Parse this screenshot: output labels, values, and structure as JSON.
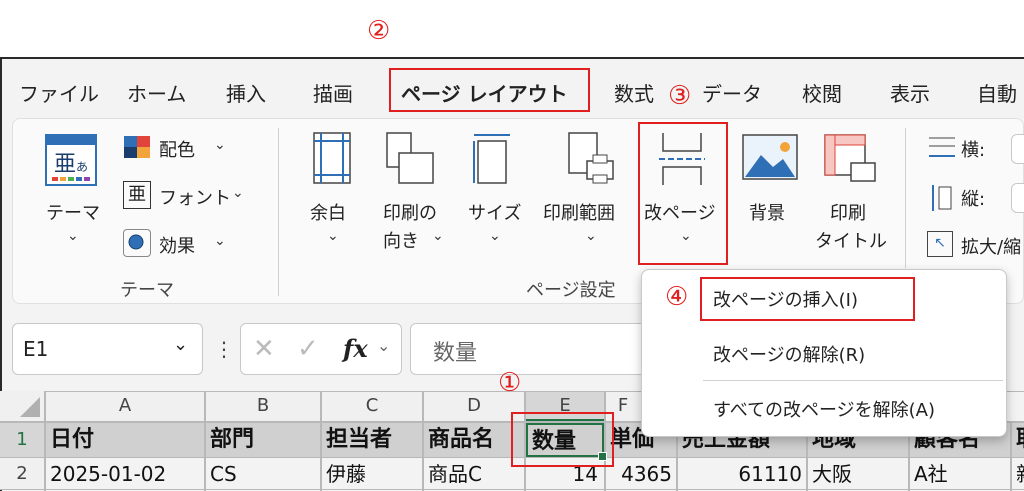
{
  "callouts": {
    "c1": "①",
    "c2": "②",
    "c3": "③",
    "c4": "④"
  },
  "menu": {
    "file": "ファイル",
    "home": "ホーム",
    "insert": "挿入",
    "draw": "描画",
    "page_layout": "ページ レイアウト",
    "formulas": "数式",
    "data": "データ",
    "review": "校閲",
    "view": "表示",
    "automate": "自動"
  },
  "ribbon": {
    "theme_group": {
      "themes_label": "テーマ",
      "colors": "配色",
      "fonts": "フォント",
      "effects": "効果",
      "group_label": "テーマ"
    },
    "margins": "余白",
    "orientation_1": "印刷の",
    "orientation_2": "向き",
    "size": "サイズ",
    "print_area": "印刷範囲",
    "breaks": "改ページ",
    "background": "背景",
    "print_titles_1": "印刷",
    "print_titles_2": "タイトル",
    "page_setup_label": "ページ設定",
    "width": "横:",
    "height": "縦:",
    "scale": "拡大/縮"
  },
  "formula_bar": {
    "name_box": "E1",
    "fx": "fx",
    "content": "数量"
  },
  "columns": [
    "A",
    "B",
    "C",
    "D",
    "E",
    "F"
  ],
  "rows": {
    "r1": {
      "num": "1",
      "cells": [
        "日付",
        "部門",
        "担当者",
        "商品名",
        "数量",
        "単価",
        "売上金額",
        "地域",
        "顧客名",
        "取"
      ]
    },
    "r2": {
      "num": "2",
      "cells": [
        "2025-01-02",
        "CS",
        "伊藤",
        "商品C",
        "14",
        "4365",
        "61110",
        "大阪",
        "A社",
        "新"
      ]
    }
  },
  "dropdown": {
    "insert": "改ページの挿入(I)",
    "remove": "改ページの解除(R)",
    "reset": "すべての改ページを解除(A)"
  },
  "colors": {
    "accent": "#e02020",
    "excel_green": "#217346"
  }
}
